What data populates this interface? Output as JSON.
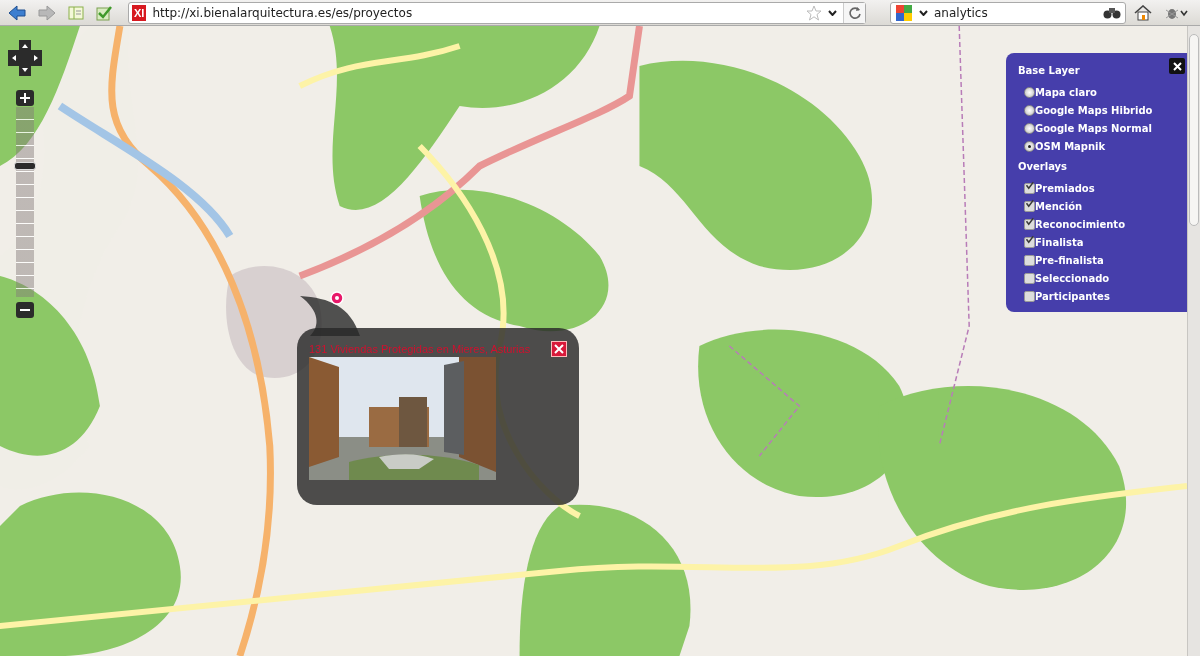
{
  "browser": {
    "favicon_text": "XI",
    "url": "http://xi.bienalarquitectura.es/es/proyectos",
    "search_query": "analytics"
  },
  "map": {
    "zoom_slider": {
      "level": 0.7
    }
  },
  "layer_switcher": {
    "base_layer_title": "Base Layer",
    "base_layers": [
      {
        "label": "Mapa claro",
        "selected": false
      },
      {
        "label": "Google Maps Hibrido",
        "selected": false
      },
      {
        "label": "Google Maps Normal",
        "selected": false
      },
      {
        "label": "OSM Mapnik",
        "selected": true
      }
    ],
    "overlays_title": "Overlays",
    "overlays": [
      {
        "label": "Premiados",
        "checked": true
      },
      {
        "label": "Mención",
        "checked": true
      },
      {
        "label": "Reconocimiento",
        "checked": true
      },
      {
        "label": "Finalista",
        "checked": true
      },
      {
        "label": "Pre-finalista",
        "checked": false
      },
      {
        "label": "Seleccionado",
        "checked": false
      },
      {
        "label": "Participantes",
        "checked": false
      }
    ]
  },
  "popup": {
    "title": "131 Viviendas Protegidas en Mieres, Asturias"
  }
}
